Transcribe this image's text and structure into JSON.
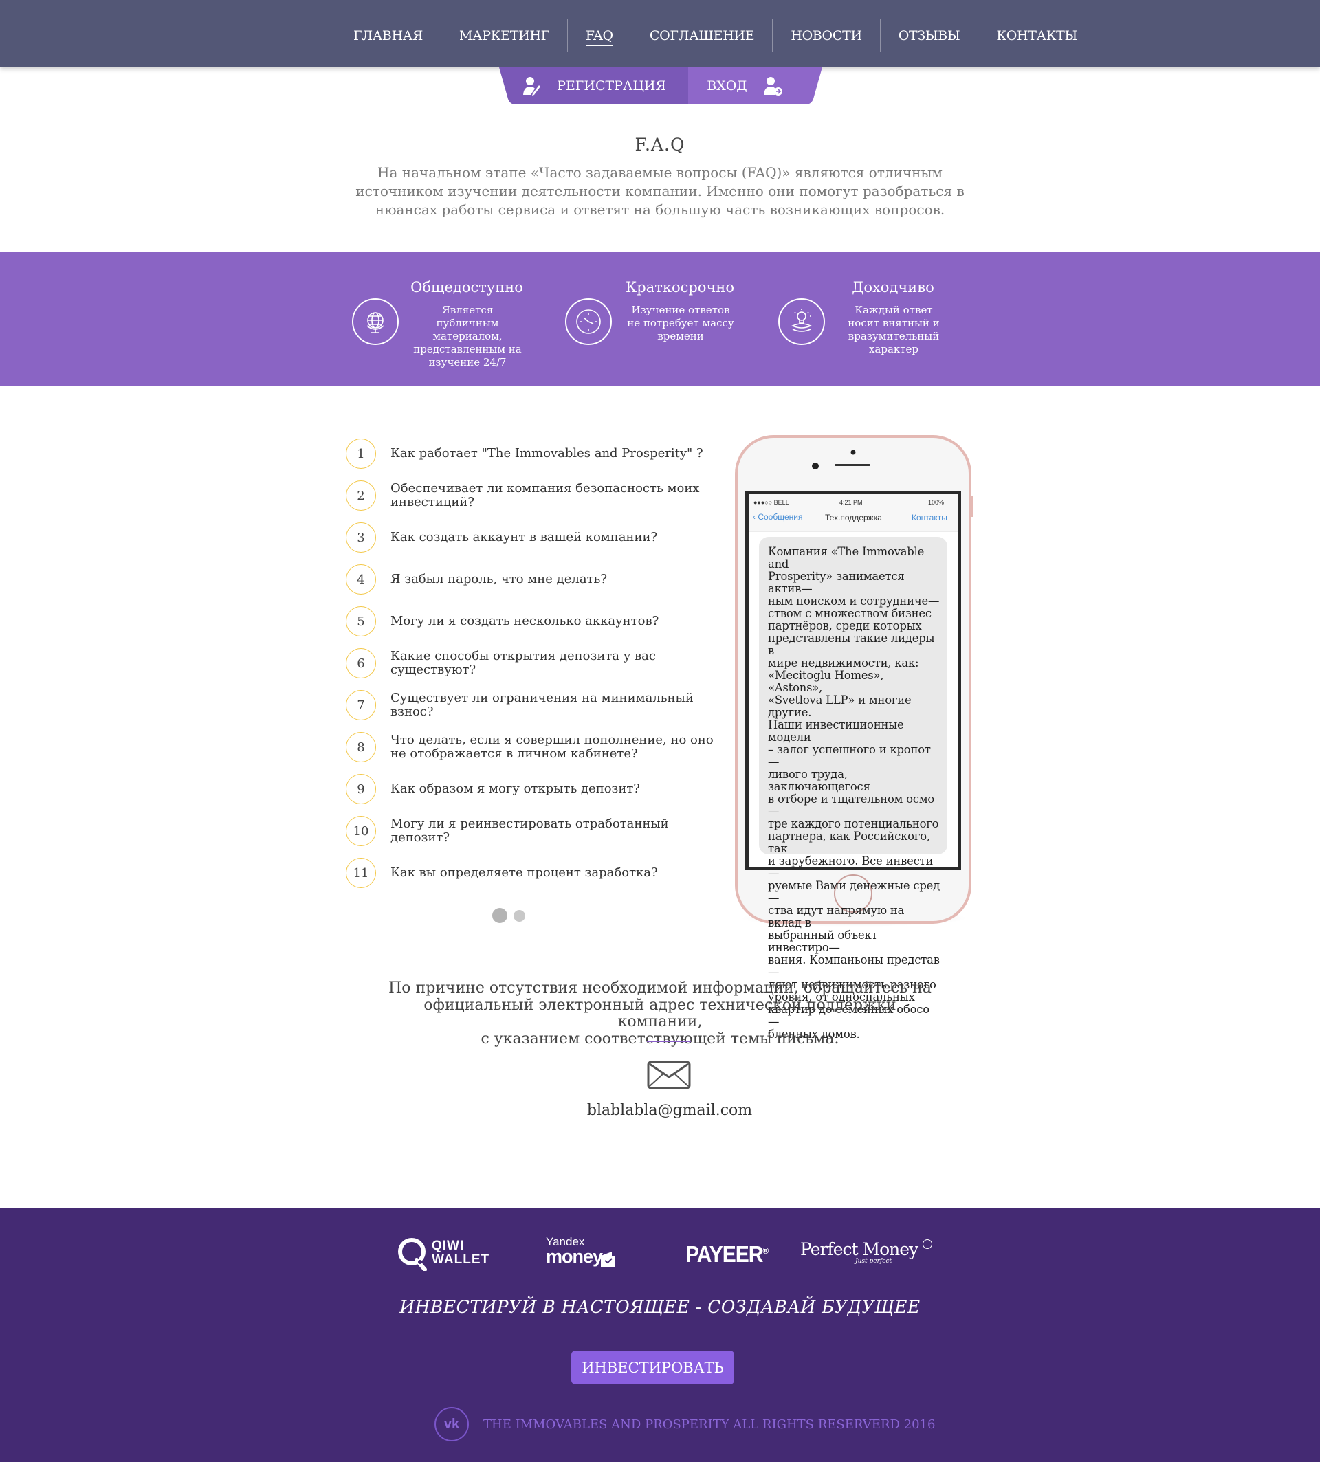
{
  "nav": {
    "items": [
      "ГЛАВНАЯ",
      "МАРКЕТИНГ",
      "FAQ",
      "СОГЛАШЕНИЕ",
      "НОВОСТИ",
      "ОТЗЫВЫ",
      "КОНТАКТЫ"
    ],
    "active": "FAQ"
  },
  "auth": {
    "register": "РЕГИСТРАЦИЯ",
    "login": "ВХОД"
  },
  "faq": {
    "title": "F.A.Q",
    "intro": "На начальном этапе «Часто задаваемые вопросы (FAQ)» являются отличным источником изучении деятельности компании. Именно они помогут разобраться в нюансах работы сервиса и ответят на большую часть возникающих вопросов."
  },
  "features": [
    {
      "title": "Общедоступно",
      "desc": "Является публичным материалом, представленным на изучение 24/7",
      "icon": "globe-icon"
    },
    {
      "title": "Краткосрочно",
      "desc": "Изучение ответов не потребует массу времени",
      "icon": "clock-icon"
    },
    {
      "title": "Доходчиво",
      "desc": "Каждый ответ носит внятный и вразумительный характер",
      "icon": "lightbulb-icon"
    }
  ],
  "questions": [
    {
      "n": "1",
      "q": "Как работает \"The Immovables and Prosperity\" ?"
    },
    {
      "n": "2",
      "q": "Обеспечивает ли компания безопасность моих инвестиций?"
    },
    {
      "n": "3",
      "q": "Как создать аккаунт в вашей компании?"
    },
    {
      "n": "4",
      "q": "Я забыл пароль, что мне делать?"
    },
    {
      "n": "5",
      "q": "Могу ли я создать несколько аккаунтов?"
    },
    {
      "n": "6",
      "q": "Какие способы открытия депозита у вас существуют?"
    },
    {
      "n": "7",
      "q": "Существует ли ограничения на минимальный взнос?"
    },
    {
      "n": "8",
      "q": "Что делать, если я совершил пополнение, но оно не отображается в личном кабинете?"
    },
    {
      "n": "9",
      "q": "Как образом я могу открыть депозит?"
    },
    {
      "n": "10",
      "q": "Могу ли я реинвестировать отработанный депозит?"
    },
    {
      "n": "11",
      "q": "Как вы определяете процент заработка?"
    }
  ],
  "pager": {
    "pages": 2,
    "active": 1
  },
  "phone": {
    "carrier": "●●●○○ BELL",
    "time": "4:21 PM",
    "battery": "100%",
    "back": "Сообщения",
    "title": "Тех.поддержка",
    "contacts": "Контакты",
    "message_lines": [
      "Компания «The Immovable and",
      "Prosperity» занимается актив—",
      "ным поиском и сотрудниче—",
      "ством с множеством бизнес",
      "партнёров, среди которых",
      "представлены такие лидеры в",
      "мире недвижимости, как:",
      "«Mecitoglu Homes», «Astons»,",
      "«Svetlova LLP» и многие другие.",
      "Наши инвестиционные модели",
      "– залог успешного и кропот—",
      "ливого труда, заключающегося",
      "в отборе и тщательном осмо—",
      "тре каждого потенциального",
      "партнера, как Российского, так",
      "и зарубежного. Все инвести—",
      "руемые Вами денежные сред—",
      "ства идут напрямую на вклад в",
      "выбранный объект инвестиро—",
      "вания. Компаньоны представ—",
      "ляют недвижимость разного",
      "уровня, от односпальных",
      "квартир до семейных обосо—",
      "бленных домов."
    ]
  },
  "contact": {
    "text_lines": [
      "По причине отсутствия необходимой информации, обращайтесь на",
      "официальный электронный адрес технической поддержки компании,",
      "с указанием соответствующей темы письма."
    ],
    "email": "blablabla@gmail.com"
  },
  "footer": {
    "payments": {
      "qiwi": [
        "QIWI",
        "WALLET"
      ],
      "yandex": [
        "Yandex",
        "money"
      ],
      "payeer": "PAYEER",
      "payeer_mark": "®",
      "perfect": "Perfect Money",
      "perfect_sub": "Just perfect"
    },
    "slogan": "ИНВЕСТИРУЙ В НАСТОЯЩЕЕ - СОЗДАВАЙ БУДУЩЕЕ",
    "invest_button": "ИНВЕСТИРОВАТЬ",
    "vk": "vk",
    "copyright": "THE IMMOVABLES AND PROSPERITY ALL RIGHTS RESERVERD 2016"
  },
  "colors": {
    "nav_bg": "#535776",
    "band": "#8a64c4",
    "auth_left": "#7a58b7",
    "auth_right": "#8e67c9",
    "footer": "#442a73",
    "number_ring": "#f3c84a",
    "button": "#8a5fe0"
  }
}
